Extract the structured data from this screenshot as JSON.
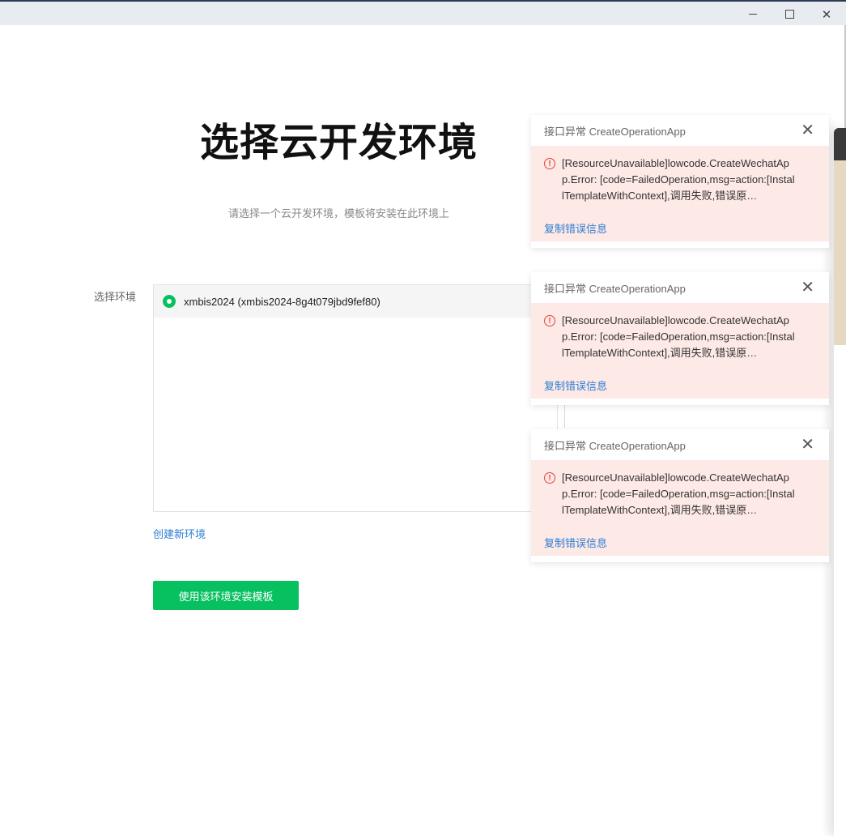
{
  "window": {
    "minimize_glyph": "–",
    "maximize_glyph": "☐",
    "close_glyph": "✕"
  },
  "main": {
    "title": "选择云开发环境",
    "subtitle": "请选择一个云开发环境，模板将安装在此环境上",
    "env_label": "选择环境",
    "environments": [
      {
        "name": "xmbis2024 (xmbis2024-8g4t079jbd9fef80)",
        "selected": true
      }
    ],
    "create_env_link": "创建新环境",
    "install_button": "使用该环境安装模板"
  },
  "toasts": [
    {
      "title": "接口异常 CreateOperationApp",
      "message": "[ResourceUnavailable]lowcode.CreateWechatApp.Error: [code=FailedOperation,msg=action:[InstallTemplateWithContext],调用失败,错误原…",
      "copy_link": "复制错误信息"
    },
    {
      "title": "接口异常 CreateOperationApp",
      "message": "[ResourceUnavailable]lowcode.CreateWechatApp.Error: [code=FailedOperation,msg=action:[InstallTemplateWithContext],调用失败,错误原…",
      "copy_link": "复制错误信息"
    },
    {
      "title": "接口异常 CreateOperationApp",
      "message": "[ResourceUnavailable]lowcode.CreateWechatApp.Error: [code=FailedOperation,msg=action:[InstallTemplateWithContext],调用失败,错误原…",
      "copy_link": "复制错误信息"
    }
  ],
  "colors": {
    "primary_green": "#07c160",
    "link_blue": "#2d7fd3",
    "error_red": "#e0443c",
    "error_bg": "#fde9e6"
  },
  "icons": {
    "toast_close": "close-icon",
    "error": "error-circle-icon",
    "radio": "radio-selected-icon"
  }
}
